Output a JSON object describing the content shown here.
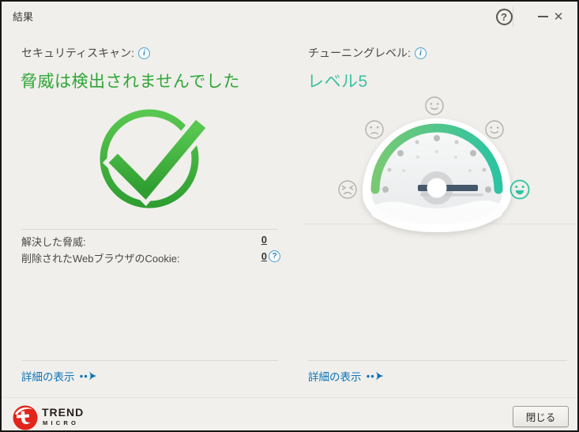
{
  "window": {
    "title": "結果"
  },
  "icons": {
    "help": "?",
    "info": "i",
    "close": "✕"
  },
  "left_panel": {
    "header": "セキュリティスキャン:",
    "headline": "脅威は検出されませんでした",
    "stats": [
      {
        "label": "解決した脅威:",
        "value": "0"
      },
      {
        "label": "削除されたWebブラウザのCookie:",
        "value": "0"
      }
    ],
    "details_link": "詳細の表示"
  },
  "right_panel": {
    "header": "チューニングレベル:",
    "headline": "レベル5",
    "details_link": "詳細の表示",
    "gauge": {
      "levels": 5,
      "active_level": 5
    }
  },
  "footer": {
    "brand_line1": "TREND",
    "brand_line2": "MICRO",
    "close_button": "閉じる"
  },
  "colors": {
    "background": "#f0efeb",
    "headline_green": "#2fa636",
    "headline_teal": "#3cc0a0",
    "link_blue": "#0c74ba",
    "info_blue": "#4aa0d5",
    "check_green_light": "#58c750",
    "check_green_dark": "#2f9e31",
    "arc_start": "#79c873",
    "arc_end": "#2bc4a3",
    "needle": "#45576a",
    "brand_red": "#e1251b"
  }
}
